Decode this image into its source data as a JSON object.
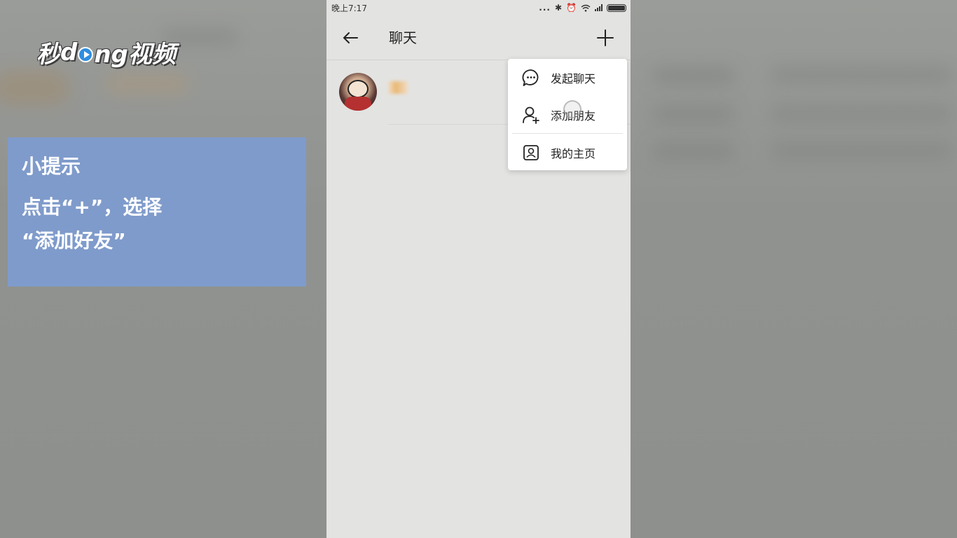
{
  "logo": {
    "text_before": "秒",
    "text_mid": "d",
    "text_after": "ng视频",
    "play_icon": "play-icon"
  },
  "tip": {
    "title": "小提示",
    "line1": "点击“+”，选择",
    "line2": "“添加好友”"
  },
  "status_bar": {
    "time": "晚上7:17",
    "icons": [
      "more-dots-icon",
      "bluetooth-icon",
      "alarm-icon",
      "wifi-icon",
      "signal-icon",
      "battery-icon"
    ],
    "dots": "...",
    "bluetooth": "✱",
    "alarm": "⏰"
  },
  "nav": {
    "title": "聊天",
    "back_icon": "back-arrow-icon",
    "plus_icon": "plus-icon"
  },
  "chat_list": [
    {
      "avatar": "avatar-image",
      "name_blurred": true
    }
  ],
  "menu": {
    "items": [
      {
        "label": "发起聊天",
        "icon": "chat-bubble-icon"
      },
      {
        "label": "添加朋友",
        "icon": "add-person-icon"
      },
      {
        "label": "我的主页",
        "icon": "profile-card-icon"
      }
    ]
  },
  "colors": {
    "tip_bg": "#7f9bcb",
    "phone_bg": "#e3e3e1",
    "side_bg": "#8f918e",
    "popup_bg": "#ffffff"
  }
}
